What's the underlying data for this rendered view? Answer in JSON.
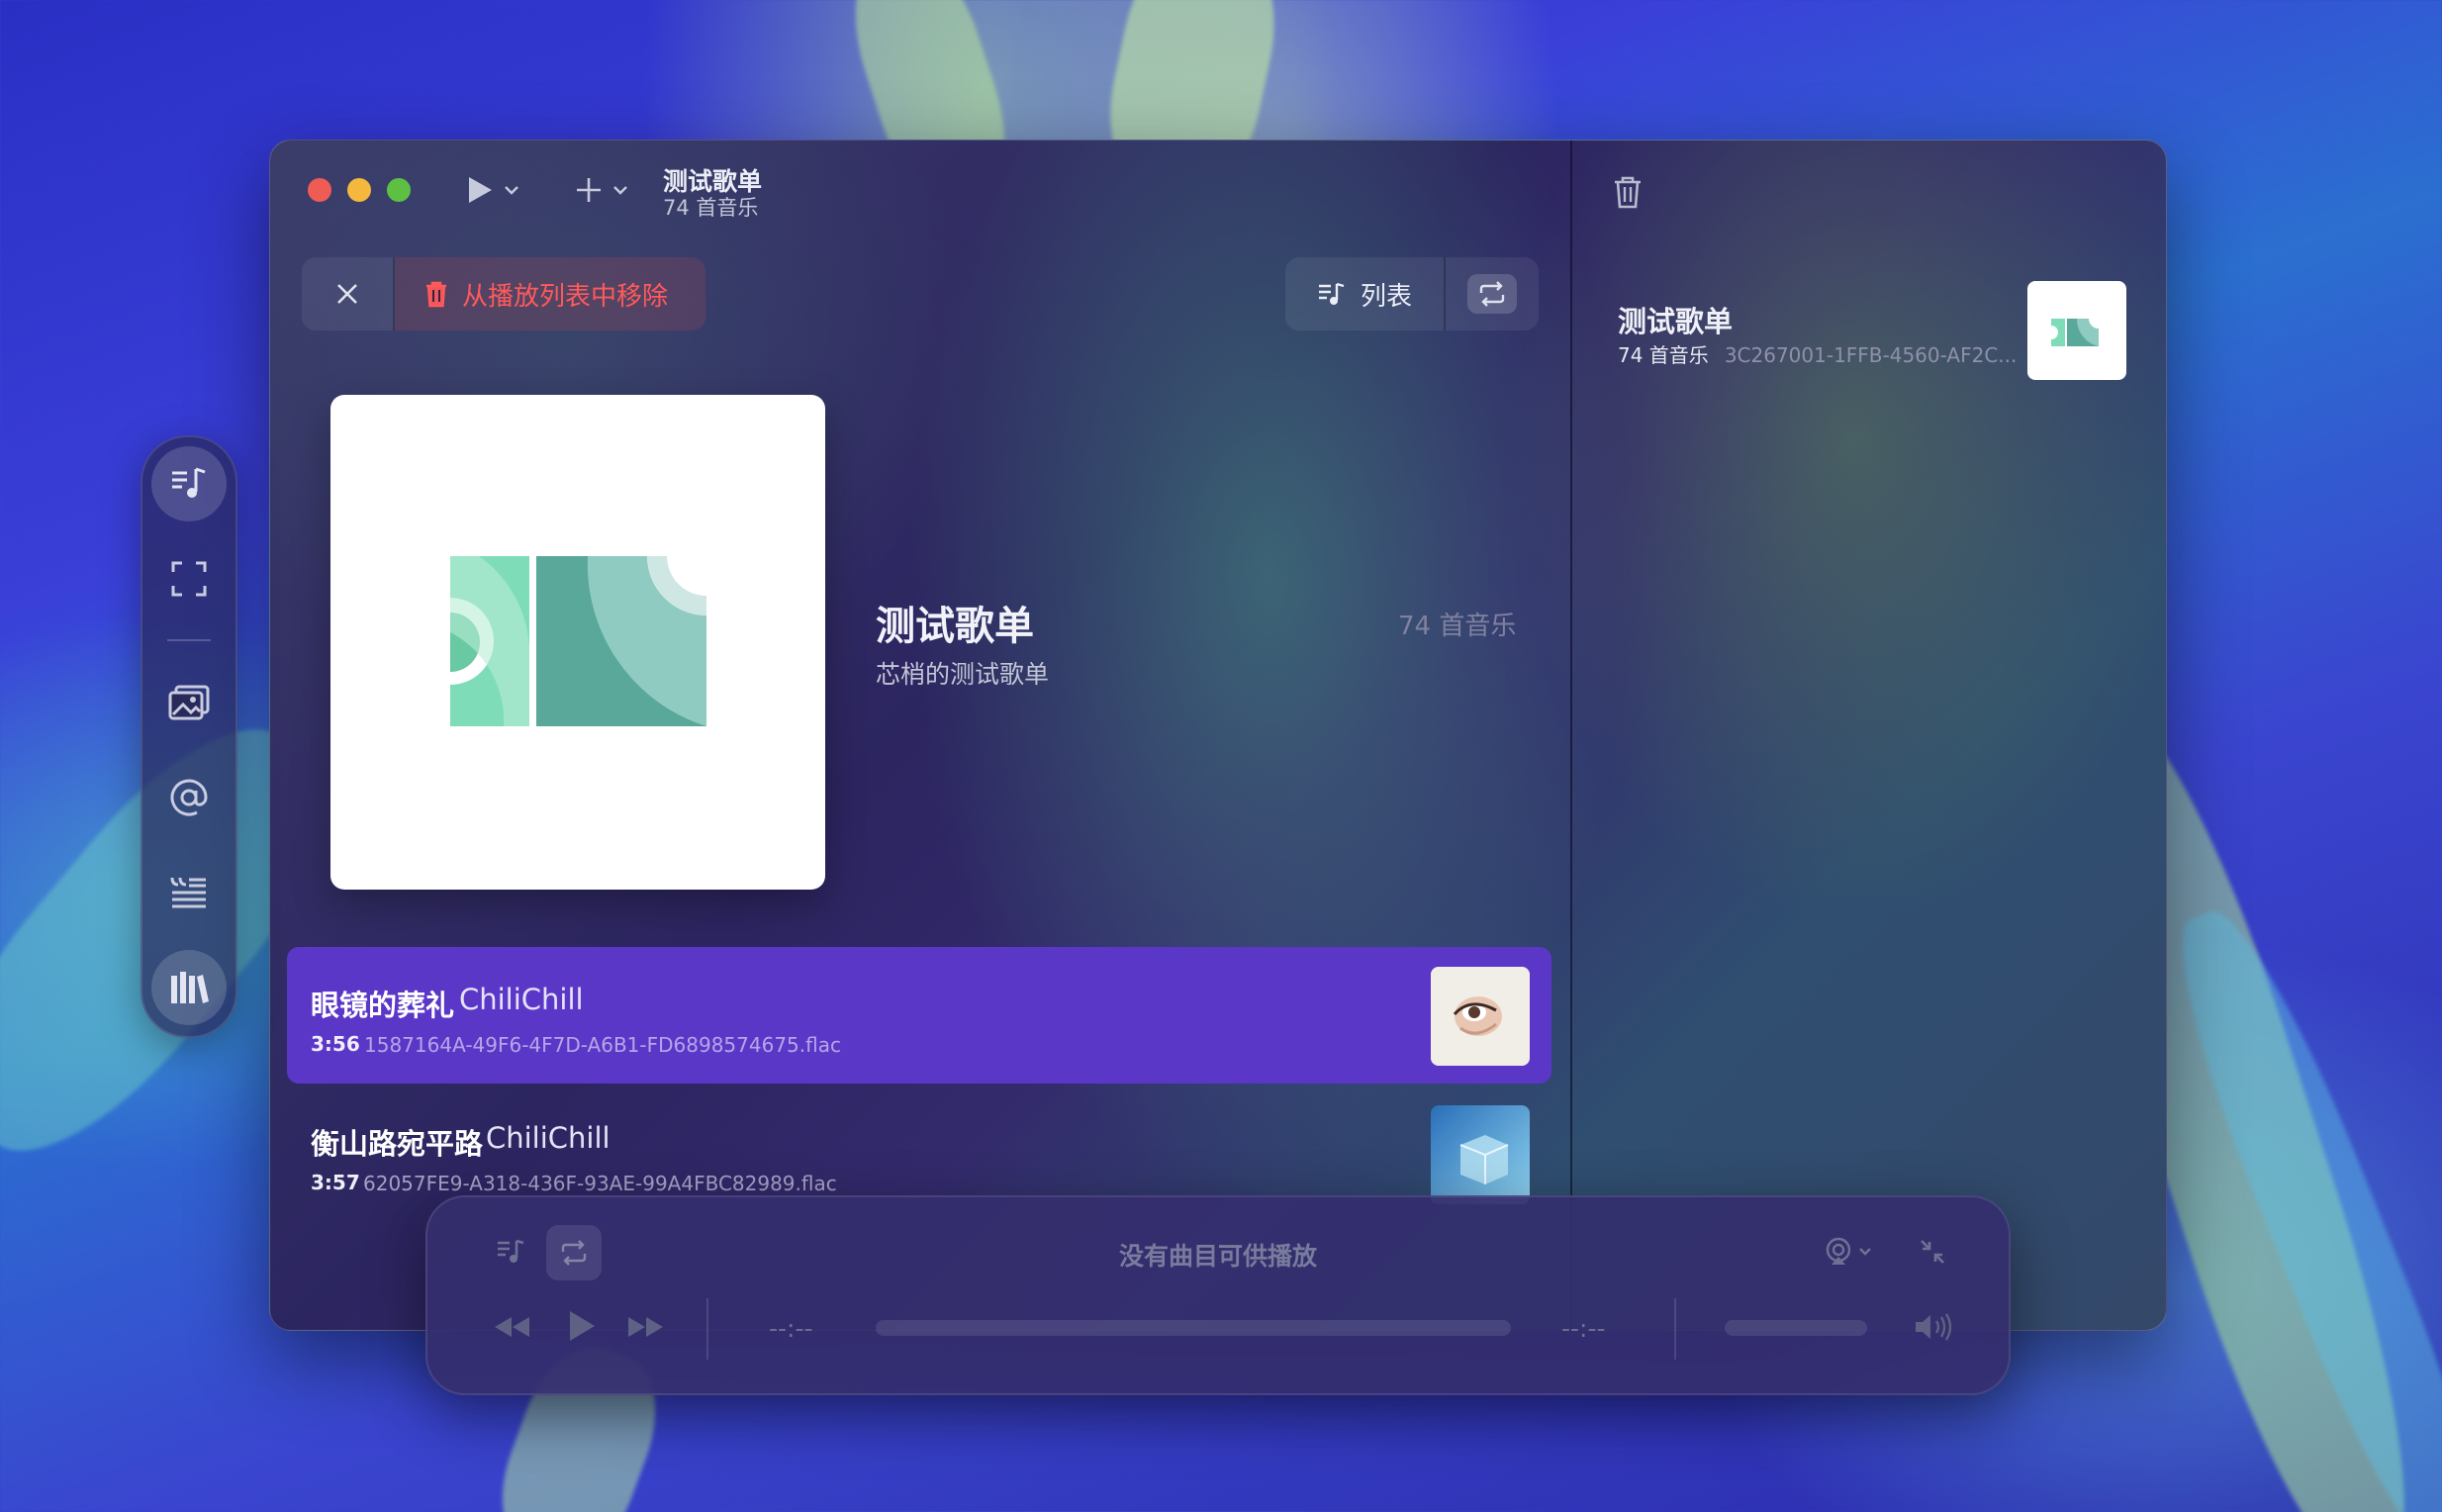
{
  "window": {
    "title": "测试歌单",
    "subtitle": "74 首音乐"
  },
  "toolbar": {
    "remove_label": "从播放列表中移除",
    "list_label": "列表"
  },
  "playlist": {
    "name": "测试歌单",
    "description": "芯梢的测试歌单",
    "count": "74 首音乐"
  },
  "tracks": [
    {
      "name": "眼镜的葬礼",
      "artist": "ChiliChill",
      "duration": "3:56",
      "file": "1587164A-49F6-4F7D-A6B1-FD6898574675.flac",
      "selected": true
    },
    {
      "name": "衡山路宛平路",
      "artist": "ChiliChill",
      "duration": "3:57",
      "file": "62057FE9-A318-436F-93AE-99A4FBC82989.flac",
      "selected": false
    }
  ],
  "side_panel": {
    "name": "测试歌单",
    "count": "74 首音乐",
    "id": "3C267001-1FFB-4560-AF2C..."
  },
  "player": {
    "status": "没有曲目可供播放",
    "current_time": "--:--",
    "total_time": "--:--"
  },
  "colors": {
    "accent_selected": "#5b37c7",
    "danger": "#ff5a5a",
    "traffic_red": "#ee5c54",
    "traffic_yellow": "#f3b83d",
    "traffic_green": "#5dc043"
  }
}
